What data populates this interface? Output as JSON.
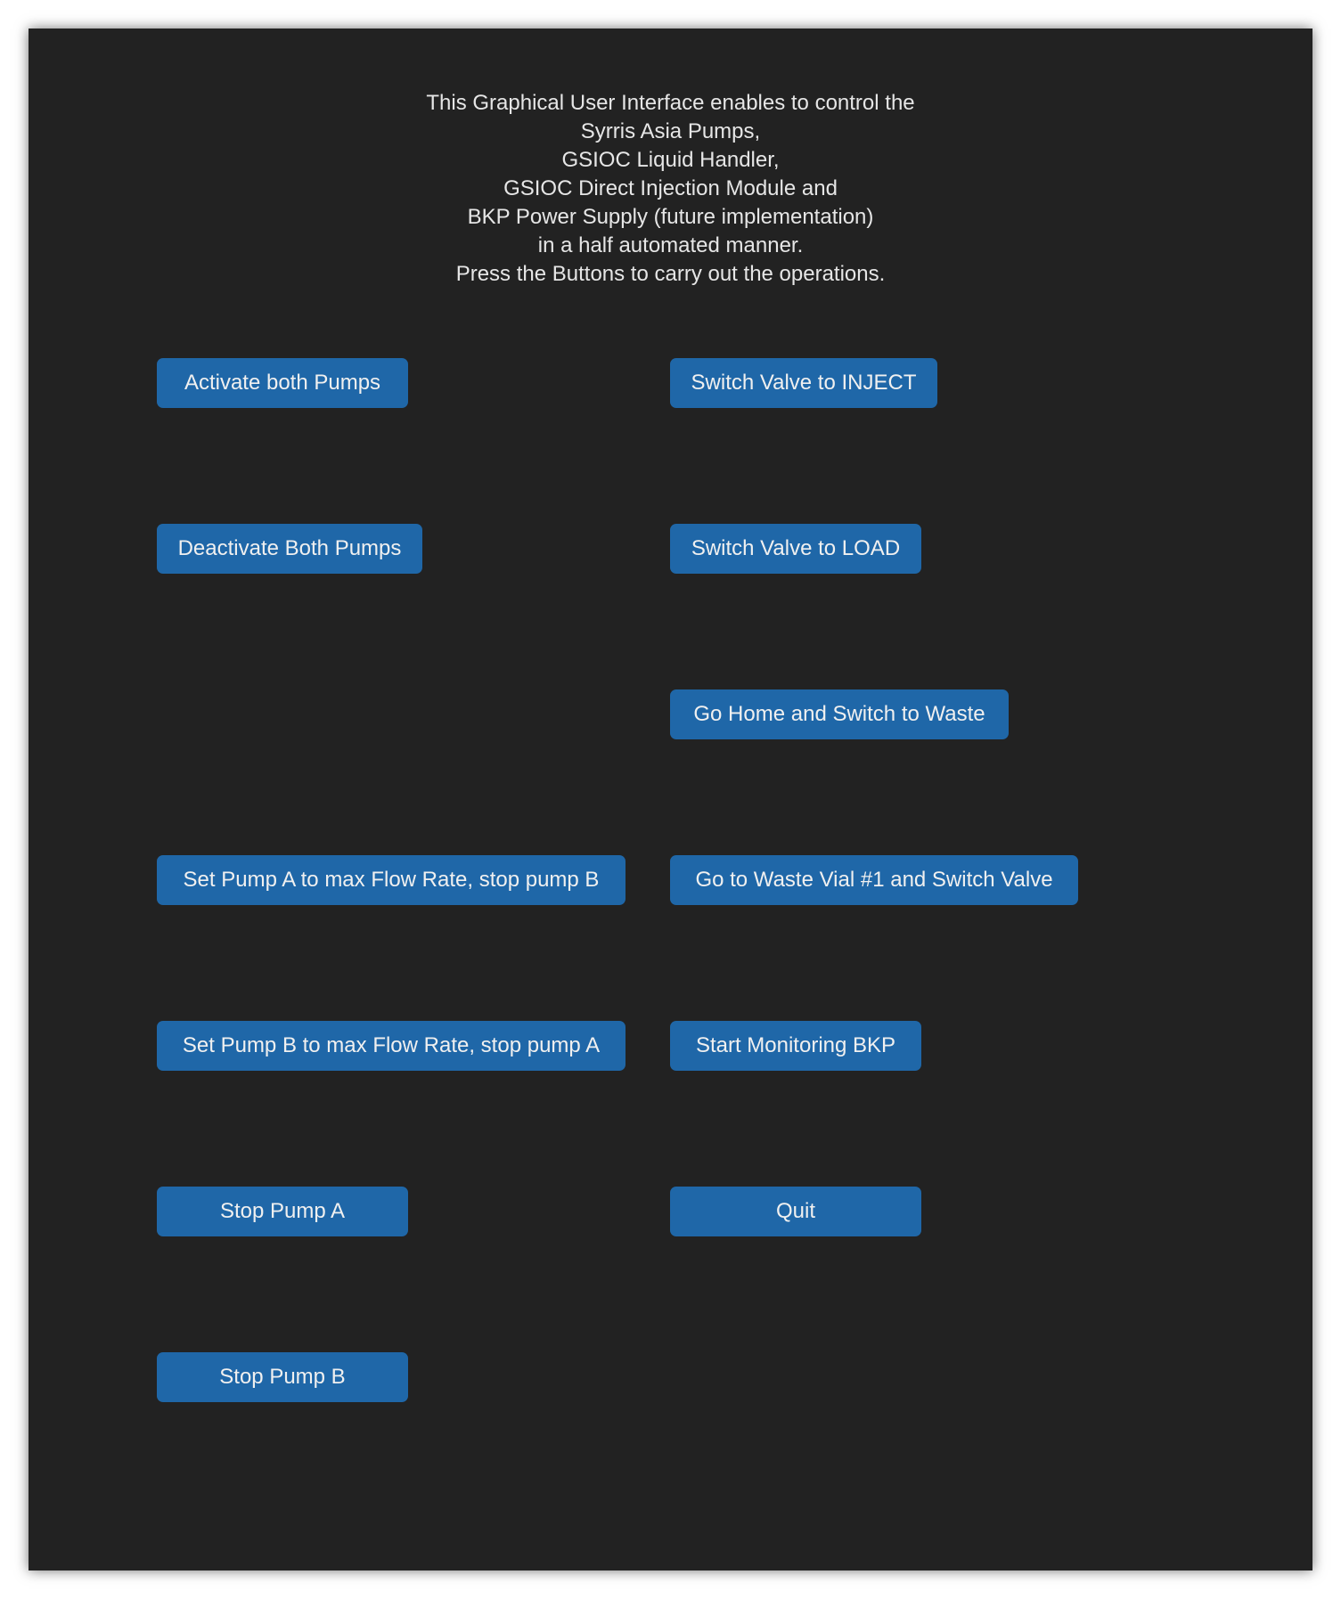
{
  "description": {
    "lines": [
      "This Graphical User Interface enables to control the",
      "Syrris Asia Pumps,",
      "GSIOC Liquid Handler,",
      "GSIOC Direct Injection Module and",
      "BKP Power Supply (future implementation)",
      "in a half automated manner.",
      "Press the Buttons to carry out the operations."
    ]
  },
  "buttons": {
    "activate_both_pumps": "Activate both Pumps",
    "deactivate_both_pumps": "Deactivate Both Pumps",
    "set_pump_a_max": "Set Pump A to max Flow Rate, stop pump B",
    "set_pump_b_max": "Set Pump B to max Flow Rate, stop pump A",
    "stop_pump_a": "Stop Pump A",
    "stop_pump_b": "Stop Pump B",
    "switch_valve_inject": "Switch Valve to INJECT",
    "switch_valve_load": "Switch Valve to LOAD",
    "go_home_waste": "Go Home and Switch to Waste",
    "go_waste_vial": "Go to Waste Vial #1 and Switch Valve",
    "start_monitoring_bkp": "Start Monitoring BKP",
    "quit": "Quit"
  },
  "colors": {
    "background": "#222222",
    "button": "#1f67a8",
    "text": "#e6e6e6"
  }
}
